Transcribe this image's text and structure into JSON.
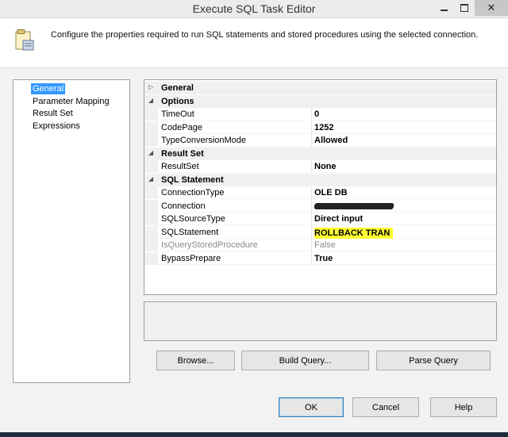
{
  "window": {
    "title": "Execute SQL Task Editor",
    "close_glyph": "✕"
  },
  "header": {
    "description": "Configure the properties required to run SQL statements and stored procedures using the selected connection.",
    "icon": "task-editor-icon"
  },
  "nav": {
    "items": [
      {
        "label": "General",
        "selected": true
      },
      {
        "label": "Parameter Mapping",
        "selected": false
      },
      {
        "label": "Result Set",
        "selected": false
      },
      {
        "label": "Expressions",
        "selected": false
      }
    ]
  },
  "grid": {
    "collapsed_glyph": "▷",
    "expanded_glyph": "◢",
    "categories": {
      "general": "General",
      "options": "Options",
      "result_set": "Result Set",
      "sql_statement": "SQL Statement"
    },
    "properties": {
      "timeout": {
        "name": "TimeOut",
        "value": "0"
      },
      "codepage": {
        "name": "CodePage",
        "value": "1252"
      },
      "type_conversion_mode": {
        "name": "TypeConversionMode",
        "value": "Allowed"
      },
      "result_set": {
        "name": "ResultSet",
        "value": "None"
      },
      "connection_type": {
        "name": "ConnectionType",
        "value": "OLE DB"
      },
      "connection": {
        "name": "Connection",
        "value": ""
      },
      "sql_source_type": {
        "name": "SQLSourceType",
        "value": "Direct input"
      },
      "sql_statement": {
        "name": "SQLStatement",
        "value": "ROLLBACK TRAN"
      },
      "is_query_stored_procedure": {
        "name": "IsQueryStoredProcedure",
        "value": "False"
      },
      "bypass_prepare": {
        "name": "BypassPrepare",
        "value": "True"
      }
    }
  },
  "buttons": {
    "browse": "Browse...",
    "build_query": "Build Query...",
    "parse_query": "Parse Query",
    "ok": "OK",
    "cancel": "Cancel",
    "help": "Help"
  },
  "colors": {
    "selection": "#3399ff",
    "highlight": "#ffff33"
  }
}
